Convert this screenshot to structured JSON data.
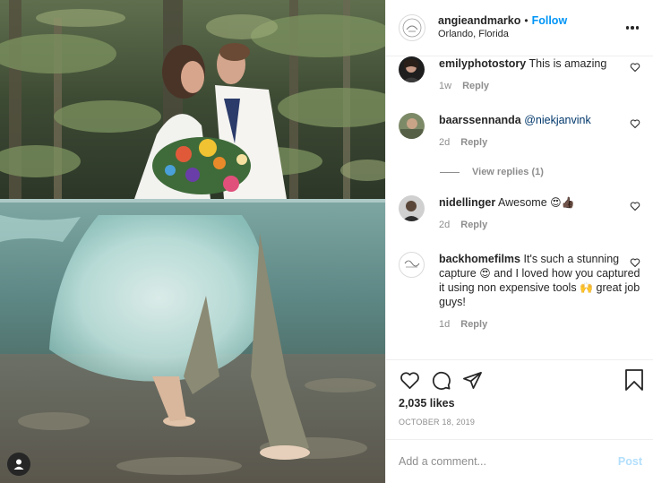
{
  "header": {
    "username": "angieandmarko",
    "separator": "•",
    "follow_label": "Follow",
    "location": "Orlando, Florida",
    "more_icon": "more-horizontal-icon"
  },
  "comments": [
    {
      "user": "emilyphotostory",
      "text": "This is amazing",
      "time": "1w",
      "reply_label": "Reply"
    },
    {
      "user": "baarssennanda",
      "mention": "@niekjanvink",
      "text": "",
      "time": "2d",
      "reply_label": "Reply",
      "view_replies": "View replies (1)"
    },
    {
      "user": "nidellinger",
      "text": "Awesome",
      "emoji": "😍👍🏿",
      "time": "2d",
      "reply_label": "Reply"
    },
    {
      "user": "backhomefilms",
      "text_1": "It's such a stunning capture",
      "emoji_1": "😍",
      "text_2": "and I loved how you captured it using non expensive tools",
      "emoji_2": "🙌",
      "text_3": "great job guys!",
      "time": "1d",
      "reply_label": "Reply"
    }
  ],
  "actions": {
    "icons": [
      "heart-icon",
      "comment-icon",
      "share-icon",
      "bookmark-icon"
    ],
    "likes": "2,035 likes",
    "date": "OCTOBER 18, 2019"
  },
  "add_comment": {
    "placeholder": "Add a comment...",
    "post_label": "Post"
  },
  "colors": {
    "link_blue": "#0095f6",
    "post_disabled": "#b2dffc",
    "muted": "#8e8e8e",
    "text": "#262626"
  }
}
